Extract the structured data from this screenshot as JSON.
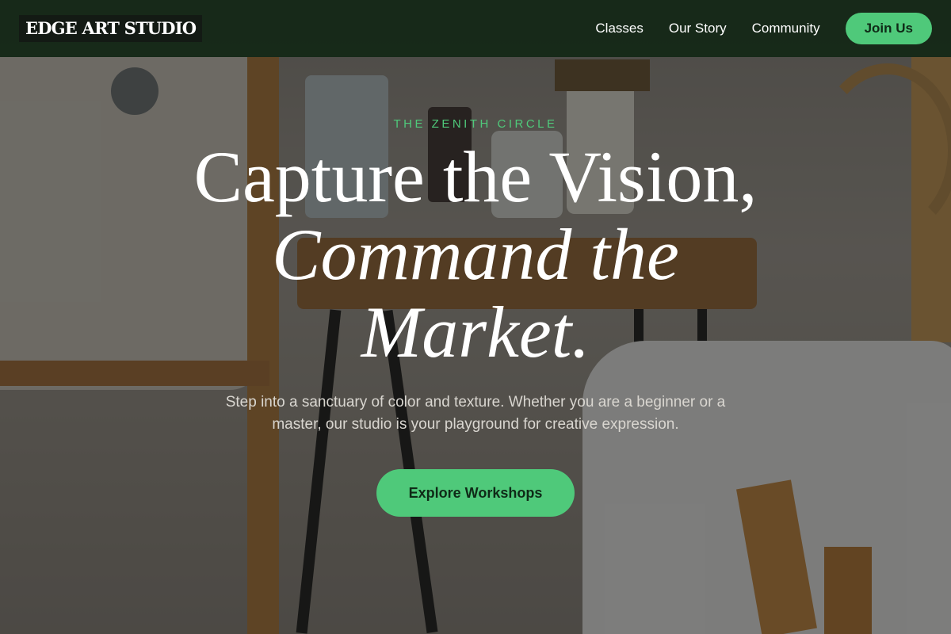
{
  "nav": {
    "logo": "EDGE ART STUDIO",
    "links": [
      "Classes",
      "Our Story",
      "Community"
    ],
    "join_label": "Join Us"
  },
  "hero": {
    "eyebrow": "THE ZENITH CIRCLE",
    "headline_line1": "Capture the Vision,",
    "headline_line2": "Command the",
    "headline_line3": "Market.",
    "subtitle": "Step into a sanctuary of color and texture. Whether you are a beginner or a master, our studio is your playground for creative expression.",
    "cta_label": "Explore Workshops"
  },
  "colors": {
    "accent": "#4fc97a",
    "nav_bg": "#0e2412",
    "text": "#ffffff"
  }
}
